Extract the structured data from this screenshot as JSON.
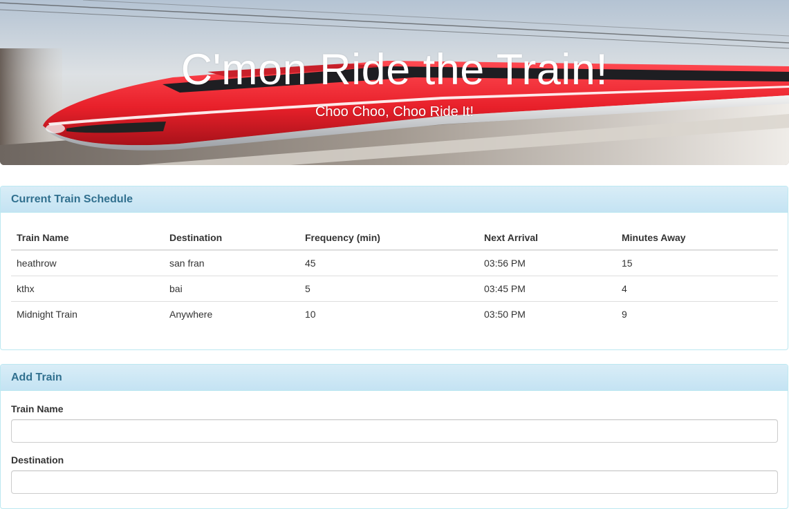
{
  "hero": {
    "title": "C'mon Ride the Train!",
    "subtitle": "Choo Choo, Choo Ride It!",
    "train_color": "#e8202a"
  },
  "schedule": {
    "heading": "Current Train Schedule",
    "columns": [
      "Train Name",
      "Destination",
      "Frequency (min)",
      "Next Arrival",
      "Minutes Away"
    ],
    "rows": [
      [
        "heathrow",
        "san fran",
        "45",
        "03:56 PM",
        "15"
      ],
      [
        "kthx",
        "bai",
        "5",
        "03:45 PM",
        "4"
      ],
      [
        "Midnight Train",
        "Anywhere",
        "10",
        "03:50 PM",
        "9"
      ]
    ]
  },
  "add_train": {
    "heading": "Add Train",
    "train_name_label": "Train Name",
    "train_name_value": "",
    "destination_label": "Destination",
    "destination_value": ""
  },
  "colors": {
    "panel_border": "#bce8f1",
    "panel_heading_bg": "#d9edf7",
    "panel_title": "#31708f"
  }
}
